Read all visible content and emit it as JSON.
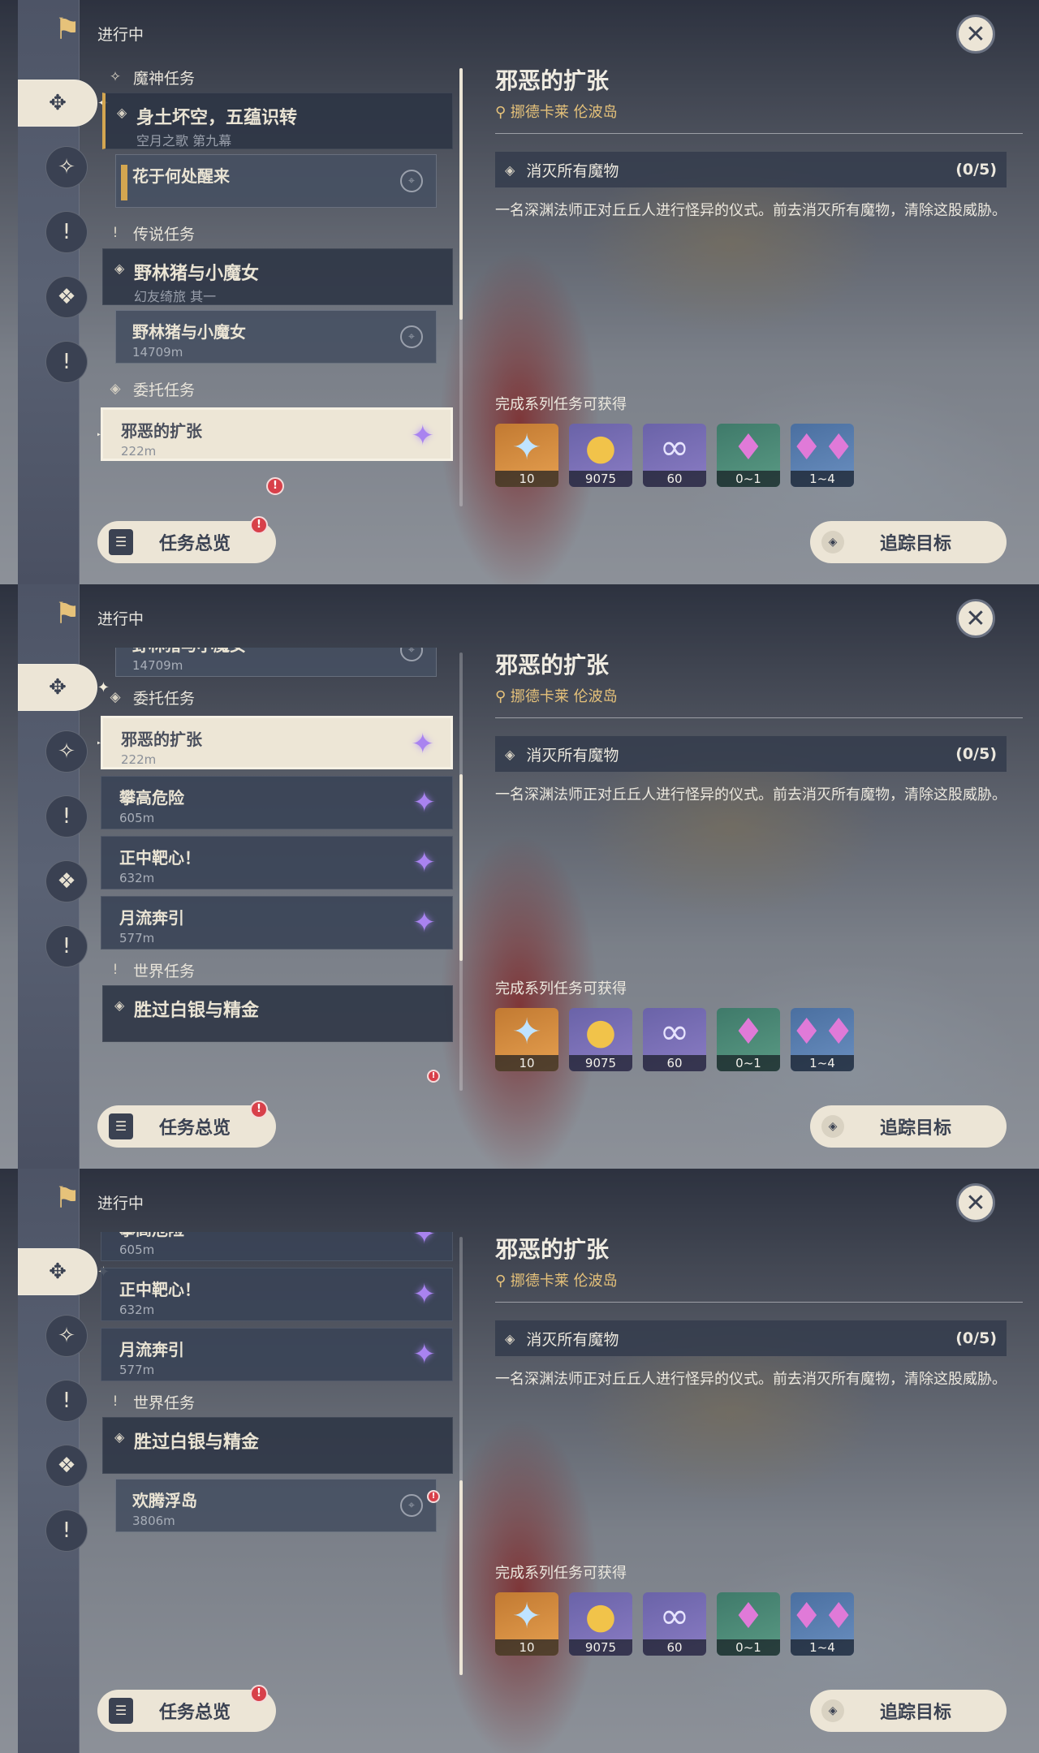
{
  "header": {
    "label": "进行中"
  },
  "quest": {
    "title": "邪恶的扩张",
    "location": "挪德卡莱 伦波岛",
    "objective": "消灭所有魔物",
    "progress": "(0/5)",
    "description": "一名深渊法师正对丘丘人进行怪异的仪式。前去消灭所有魔物，清除这股威胁。"
  },
  "rewards": {
    "title": "完成系列任务可获得",
    "items": [
      {
        "icon": "primogem-icon",
        "count": "10"
      },
      {
        "icon": "mora-icon",
        "count": "9075"
      },
      {
        "icon": "exp-icon",
        "count": "60"
      },
      {
        "icon": "crystal-icon",
        "count": "0~1"
      },
      {
        "icon": "crystal-cluster-icon",
        "count": "1~4"
      }
    ]
  },
  "sections": {
    "archon": "魔神任务",
    "story": "传说任务",
    "commission": "委托任务",
    "world": "世界任务"
  },
  "archon_quest": {
    "title": "身土坏空，五蕴识转",
    "sub": "空月之歌 第九幕",
    "step": "花于何处醒来"
  },
  "story_quest": {
    "title": "野林猪与小魔女",
    "sub": "幻友绮旅 其一",
    "step": "野林猪与小魔女",
    "step_dist": "14709m"
  },
  "commissions": [
    {
      "title": "邪恶的扩张",
      "dist": "222m"
    },
    {
      "title": "攀高危险",
      "dist": "605m"
    },
    {
      "title": "正中靶心！",
      "dist": "632m"
    },
    {
      "title": "月流奔引",
      "dist": "577m"
    }
  ],
  "world_quest": {
    "title": "胜过白银与精金",
    "step": "欢腾浮岛",
    "step_dist": "3806m"
  },
  "buttons": {
    "overview": "任务总览",
    "track": "追踪目标"
  }
}
